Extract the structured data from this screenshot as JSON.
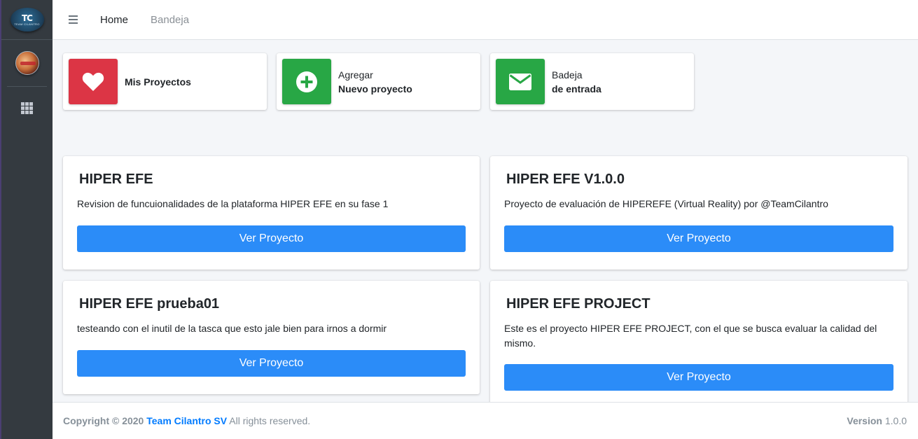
{
  "header": {
    "nav": [
      {
        "label": "Home"
      },
      {
        "label": "Bandeja"
      }
    ]
  },
  "sidebar": {
    "logo_text": "TC",
    "logo_sub": "TEAM CILANTRO"
  },
  "info_boxes": [
    {
      "line1": "",
      "line2": "Mis Proyectos",
      "icon": "heart-icon",
      "color": "#dc3545"
    },
    {
      "line1": "Agregar",
      "line2": "Nuevo proyecto",
      "icon": "plus-circle-icon",
      "color": "#28a745"
    },
    {
      "line1": "Badeja",
      "line2": "de entrada",
      "icon": "envelope-icon",
      "color": "#28a745"
    }
  ],
  "projects": [
    {
      "title": "HIPER EFE",
      "description": "Revision de funcuionalidades de la plataforma HIPER EFE en su fase 1",
      "button": "Ver Proyecto"
    },
    {
      "title": "HIPER EFE V1.0.0",
      "description": "Proyecto de evaluación de HIPEREFE (Virtual Reality) por @TeamCilantro",
      "button": "Ver Proyecto"
    },
    {
      "title": "HIPER EFE prueba01",
      "description": "testeando con el inutil de la tasca que esto jale bien para irnos a dormir",
      "button": "Ver Proyecto"
    },
    {
      "title": "HIPER EFE PROJECT",
      "description": "Este es el proyecto HIPER EFE PROJECT, con el que se busca evaluar la calidad del mismo.",
      "button": "Ver Proyecto"
    }
  ],
  "footer": {
    "copyright": "Copyright © 2020",
    "brand": "Team Cilantro SV",
    "rights": "All rights reserved.",
    "version_label": "Version",
    "version_value": "1.0.0"
  },
  "colors": {
    "sidebar": "#343a40",
    "primary_button": "#2b8cf8",
    "red": "#dc3545",
    "green": "#28a745",
    "link": "#007bff"
  }
}
